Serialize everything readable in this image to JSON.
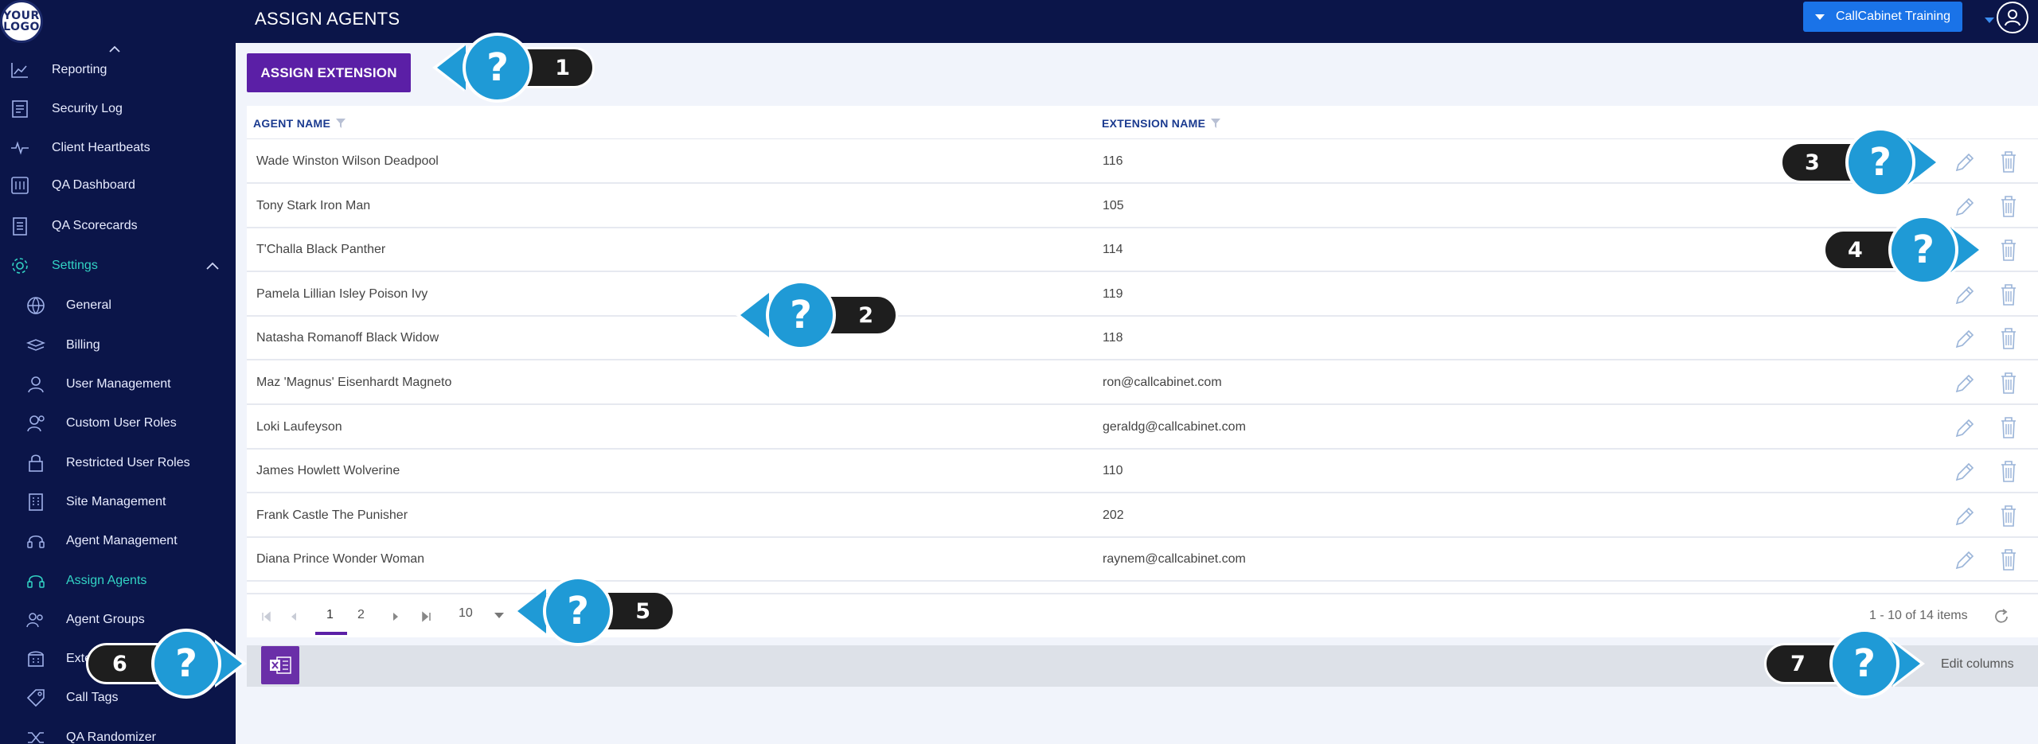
{
  "logo": {
    "line1": "YOUR",
    "line2": "LOGO"
  },
  "header": {
    "title": "ASSIGN AGENTS",
    "account_label": "CallCabinet Training"
  },
  "sidebar": {
    "items": [
      {
        "label": "Reporting",
        "icon": "chart-icon"
      },
      {
        "label": "Security Log",
        "icon": "log-icon"
      },
      {
        "label": "Client Heartbeats",
        "icon": "heartbeat-icon"
      },
      {
        "label": "QA Dashboard",
        "icon": "dashboard-icon"
      },
      {
        "label": "QA Scorecards",
        "icon": "scorecard-icon"
      },
      {
        "label": "Settings",
        "icon": "gear-icon"
      },
      {
        "label": "General",
        "icon": "globe-icon"
      },
      {
        "label": "Billing",
        "icon": "billing-icon"
      },
      {
        "label": "User Management",
        "icon": "user-icon"
      },
      {
        "label": "Custom User Roles",
        "icon": "user-roles-icon"
      },
      {
        "label": "Restricted User Roles",
        "icon": "lock-icon"
      },
      {
        "label": "Site Management",
        "icon": "building-icon"
      },
      {
        "label": "Agent Management",
        "icon": "headset-icon"
      },
      {
        "label": "Assign Agents",
        "icon": "headset-icon"
      },
      {
        "label": "Agent Groups",
        "icon": "group-icon"
      },
      {
        "label": "Extensions",
        "icon": "phone-icon"
      },
      {
        "label": "Call Tags",
        "icon": "tag-icon"
      },
      {
        "label": "QA Randomizer",
        "icon": "shuffle-icon"
      }
    ]
  },
  "toolbar": {
    "assign_label": "ASSIGN EXTENSION"
  },
  "table": {
    "columns": [
      "AGENT NAME",
      "EXTENSION NAME"
    ],
    "rows": [
      {
        "agent": "Wade Winston Wilson Deadpool",
        "extension": "116"
      },
      {
        "agent": "Tony Stark Iron Man",
        "extension": "105"
      },
      {
        "agent": "T'Challa Black Panther",
        "extension": "114"
      },
      {
        "agent": "Pamela Lillian Isley Poison Ivy",
        "extension": "119"
      },
      {
        "agent": "Natasha Romanoff Black Widow",
        "extension": "118"
      },
      {
        "agent": "Maz 'Magnus' Eisenhardt Magneto",
        "extension": "ron@callcabinet.com"
      },
      {
        "agent": "Loki Laufeyson",
        "extension": "geraldg@callcabinet.com"
      },
      {
        "agent": "James Howlett Wolverine",
        "extension": "110"
      },
      {
        "agent": "Frank Castle The Punisher",
        "extension": "202"
      },
      {
        "agent": "Diana Prince Wonder Woman",
        "extension": "raynem@callcabinet.com"
      }
    ]
  },
  "pager": {
    "pages": [
      "1",
      "2"
    ],
    "current_page": "1",
    "page_size": "10",
    "items_info": "1 - 10 of 14 items"
  },
  "footer": {
    "edit_columns_label": "Edit columns"
  },
  "callouts": {
    "c1": {
      "number": "1",
      "symbol": "?"
    },
    "c2": {
      "number": "2",
      "symbol": "?"
    },
    "c3": {
      "number": "3",
      "symbol": "?"
    },
    "c4": {
      "number": "4",
      "symbol": "?"
    },
    "c5": {
      "number": "5",
      "symbol": "?"
    },
    "c6": {
      "number": "6",
      "symbol": "?"
    },
    "c7": {
      "number": "7",
      "symbol": "?"
    }
  },
  "colors": {
    "sidebar_bg": "#0b1549",
    "accent_purple": "#5b1fa6",
    "accent_teal": "#32d3c4",
    "account_blue": "#1a73e8",
    "callout_blue": "#1f9ad6"
  }
}
